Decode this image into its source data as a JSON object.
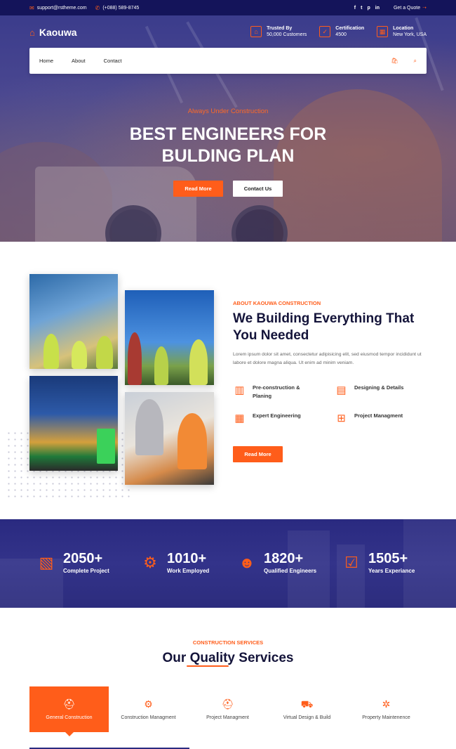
{
  "topbar": {
    "email": "support@rstheme.com",
    "phone": "(+088) 589-8745",
    "social": [
      "f",
      "t",
      "p",
      "in"
    ],
    "quote": "Get a Quote"
  },
  "header": {
    "brand": "Kaouwa",
    "infos": [
      {
        "title": "Trusted By",
        "value": "50,000 Customers",
        "icon": "house-icon"
      },
      {
        "title": "Certification",
        "value": "4500",
        "icon": "check-square-icon"
      },
      {
        "title": "Location",
        "value": "New York, USA",
        "icon": "map-icon"
      }
    ]
  },
  "nav": {
    "links": [
      "Home",
      "About",
      "Contact"
    ],
    "icons": [
      "cart-icon",
      "search-icon"
    ]
  },
  "hero": {
    "subtitle": "Always Under Construction",
    "title_line1": "BEST ENGINEERS FOR",
    "title_line2": "BULDING PLAN",
    "btn_primary": "Read More",
    "btn_secondary": "Contact Us"
  },
  "about": {
    "subtitle": "ABOUT KAOUWA CONSTRUCTION",
    "title": "We Building Everything That You Needed",
    "text": "Lorem ipsum dolor sit amet, consectetur adipisicing elit, sed eiusmod tempor incididunt ut labore et dolore magna aliqua. Ut enim ad minim veniam.",
    "features": [
      {
        "label": "Pre-construction & Planing",
        "icon": "building-icon"
      },
      {
        "label": "Designing & Details",
        "icon": "blueprint-icon"
      },
      {
        "label": "Expert Engineering",
        "icon": "tower-icon"
      },
      {
        "label": "Project Managment",
        "icon": "scaffold-icon"
      }
    ],
    "btn": "Read More"
  },
  "stats": [
    {
      "number": "2050+",
      "label": "Complete Project",
      "icon": "project-icon"
    },
    {
      "number": "1010+",
      "label": "Work Employed",
      "icon": "gear-icon"
    },
    {
      "number": "1820+",
      "label": "Qualified Engineers",
      "icon": "engineer-icon"
    },
    {
      "number": "1505+",
      "label": "Years Experiance",
      "icon": "check-box-icon"
    }
  ],
  "services": {
    "subtitle": "CONSTRUCTION SERVICES",
    "title": "Our Quality Services",
    "tabs": [
      {
        "label": "General Construction",
        "active": true
      },
      {
        "label": "Construction Managment",
        "active": false
      },
      {
        "label": "Project Managment",
        "active": false
      },
      {
        "label": "Virtual Design & Build",
        "active": false
      },
      {
        "label": "Property Maintenence",
        "active": false
      }
    ]
  },
  "colors": {
    "accent": "#ff5d1a",
    "navy": "#14145a",
    "stats_bg": "#2a2a80"
  }
}
